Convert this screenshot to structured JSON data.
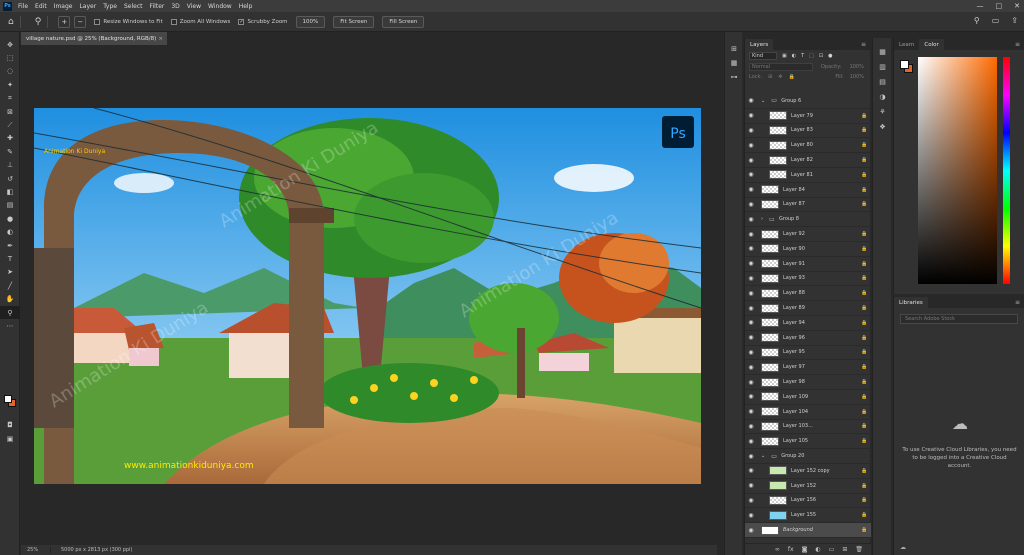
{
  "app": {
    "logo": "Ps"
  },
  "menu": [
    "File",
    "Edit",
    "Image",
    "Layer",
    "Type",
    "Select",
    "Filter",
    "3D",
    "View",
    "Window",
    "Help"
  ],
  "window_controls": {
    "minimize": "—",
    "maximize": "□",
    "close": "✕"
  },
  "options": {
    "resize_windows": "Resize Windows to Fit",
    "zoom_all": "Zoom All Windows",
    "scrubby_zoom": "Scrubby Zoom",
    "zoom_value": "100%",
    "fit_screen": "Fit Screen",
    "fill_screen": "Fill Screen"
  },
  "document": {
    "tab_title": "village nature.psd @ 25% (Background, RGB/8)",
    "status_zoom": "25%",
    "status_info": "5000 px x 2813 px (300 ppi)",
    "watermark": "Animation Ki Duniya",
    "logo_text": "Animation Ki Duniya",
    "site_text": "www.animationkiduniya.com",
    "ps_badge": "Ps"
  },
  "layers_panel": {
    "tab": "Layers",
    "filter_kind": "Kind",
    "blend_mode": "Normal",
    "opacity_label": "Opacity:",
    "opacity_value": "100%",
    "lock_label": "Lock:",
    "fill_label": "Fill:",
    "fill_value": "100%",
    "rows": [
      {
        "name": "Group 6",
        "type": "group",
        "open": true
      },
      {
        "name": "Layer 79",
        "type": "layer",
        "indent": true,
        "lock": true
      },
      {
        "name": "Layer 83",
        "type": "layer",
        "indent": true,
        "lock": true
      },
      {
        "name": "Layer 80",
        "type": "layer",
        "indent": true,
        "lock": true
      },
      {
        "name": "Layer 82",
        "type": "layer",
        "indent": true,
        "lock": true
      },
      {
        "name": "Layer 81",
        "type": "layer",
        "indent": true,
        "lock": true
      },
      {
        "name": "Layer 84",
        "type": "layer",
        "lock": true
      },
      {
        "name": "Layer 87",
        "type": "layer",
        "lock": true
      },
      {
        "name": "Group 8",
        "type": "group",
        "open": false
      },
      {
        "name": "Layer 92",
        "type": "layer",
        "lock": true
      },
      {
        "name": "Layer 90",
        "type": "layer",
        "lock": true
      },
      {
        "name": "Layer 91",
        "type": "layer",
        "lock": true
      },
      {
        "name": "Layer 93",
        "type": "layer",
        "lock": true
      },
      {
        "name": "Layer 88",
        "type": "layer",
        "lock": true
      },
      {
        "name": "Layer 89",
        "type": "layer",
        "lock": true
      },
      {
        "name": "Layer 94",
        "type": "layer",
        "lock": true
      },
      {
        "name": "Layer 96",
        "type": "layer",
        "lock": true
      },
      {
        "name": "Layer 95",
        "type": "layer",
        "lock": true
      },
      {
        "name": "Layer 97",
        "type": "layer",
        "lock": true
      },
      {
        "name": "Layer 98",
        "type": "layer",
        "lock": true
      },
      {
        "name": "Layer 109",
        "type": "layer",
        "lock": true
      },
      {
        "name": "Layer 104",
        "type": "layer",
        "lock": true
      },
      {
        "name": "Layer 103...",
        "type": "layer",
        "lock": true
      },
      {
        "name": "Layer 105",
        "type": "layer",
        "lock": true
      },
      {
        "name": "Group 20",
        "type": "group",
        "open": true
      },
      {
        "name": "Layer 152 copy",
        "type": "layer",
        "indent": true,
        "lock": true
      },
      {
        "name": "Layer 152",
        "type": "layer",
        "indent": true,
        "lock": true
      },
      {
        "name": "Layer 156",
        "type": "layer",
        "indent": true,
        "lock": true
      },
      {
        "name": "Layer 155",
        "type": "layer",
        "indent": true,
        "lock": true
      },
      {
        "name": "Background",
        "type": "background",
        "lock": true,
        "selected": true
      }
    ]
  },
  "color_panel": {
    "tabs": [
      "Learn",
      "Color"
    ],
    "foreground": "#ffffff",
    "background": "#e8632a"
  },
  "libraries_panel": {
    "tab": "Libraries",
    "search_placeholder": "Search Adobe Stock",
    "message": "To use Creative Cloud Libraries, you need to be logged into a Creative Cloud account."
  }
}
